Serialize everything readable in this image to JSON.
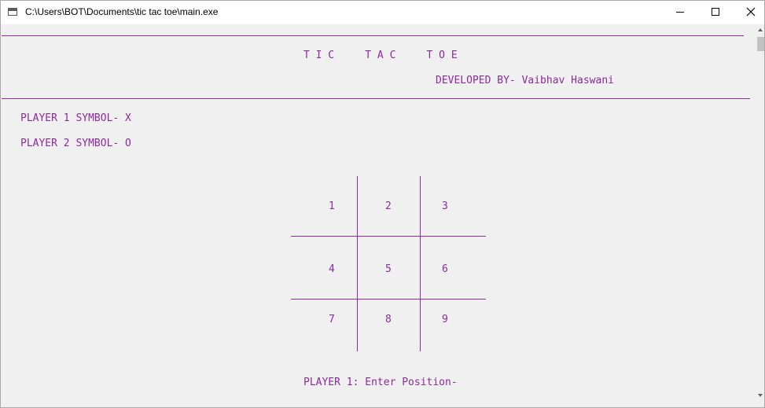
{
  "window": {
    "title": "C:\\Users\\BOT\\Documents\\tic tac toe\\main.exe",
    "accent_text_color": "#8a2c9a"
  },
  "console": {
    "heading": "T I C     T A C     T O E",
    "developer": "DEVELOPED BY- Vaibhav Haswani",
    "player1_symbol": "PLAYER 1 SYMBOL- X",
    "player2_symbol": "PLAYER 2 SYMBOL- O",
    "board": {
      "cells": [
        "1",
        "2",
        "3",
        "4",
        "5",
        "6",
        "7",
        "8",
        "9"
      ]
    },
    "prompt": "PLAYER 1: Enter Position-"
  }
}
